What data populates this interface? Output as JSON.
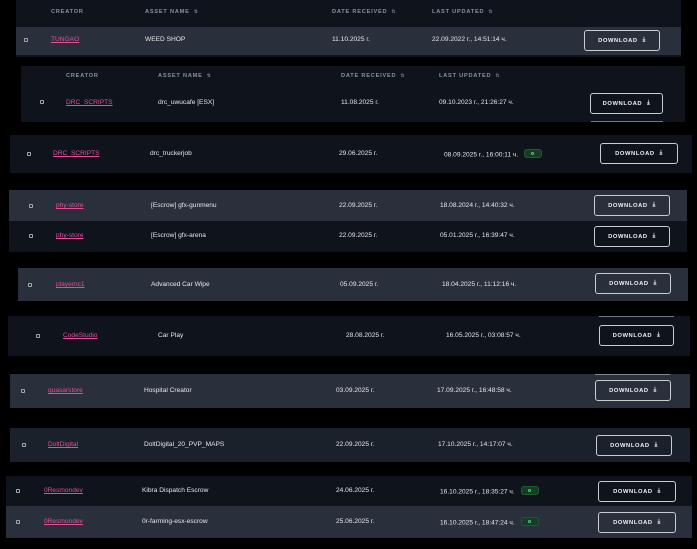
{
  "header1": {
    "creator": "CREATOR",
    "asset_name": "ASSET NAME",
    "date_received": "DATE RECEIVED",
    "last_updated": "LAST UPDATED"
  },
  "header2": {
    "creator": "CREATOR",
    "asset_name": "ASSET NAME",
    "date_received": "DATE RECEIVED",
    "last_updated": "LAST UPDATED"
  },
  "sort_glyph": "⇅",
  "download_label": "DOWNLOAD",
  "download_icon": "⤓",
  "rows": [
    {
      "creator": "TUNGAO",
      "asset": "WEED SHOP",
      "date_received": "11.10.2025 г.",
      "last_updated": "22.09.2022 г., 14:51:14 ч.",
      "badge": false
    },
    {
      "creator": "DRC_SCRIPTS",
      "asset": "drc_uwucafe [ESX]",
      "date_received": "11.08.2025 г.",
      "last_updated": "09.10.2023 г., 21:26:27 ч.",
      "badge": false
    },
    {
      "creator": "DRC_SCRIPTS",
      "asset": "drc_truckerjob",
      "date_received": "29.06.2025 г.",
      "last_updated": "08.09.2025 г., 16:00:11 ч.",
      "badge": true
    },
    {
      "creator": "phy-store",
      "asset": "[Escrow] gfx-gunmenu",
      "date_received": "22.09.2025 г.",
      "last_updated": "18.08.2024 г., 14:40:32 ч.",
      "badge": false
    },
    {
      "creator": "phy-store",
      "asset": "[Escrow] gfx-arena",
      "date_received": "22.09.2025 г.",
      "last_updated": "05.01.2025 г., 16:39:47 ч.",
      "badge": false
    },
    {
      "creator": "playernc1",
      "asset": "Advanced Car Wipe",
      "date_received": "05.09.2025 г.",
      "last_updated": "18.04.2025 г., 11:12:16 ч.",
      "badge": false
    },
    {
      "creator": "CodeStudio",
      "asset": "Car Play",
      "date_received": "28.08.2025 г.",
      "last_updated": "16.05.2025 г., 03:08:57 ч.",
      "badge": false
    },
    {
      "creator": "quasarstore",
      "asset": "Hospital Creator",
      "date_received": "03.09.2025 г.",
      "last_updated": "17.09.2025 г., 16:48:58 ч.",
      "badge": false
    },
    {
      "creator": "DoltDigital",
      "asset": "DoltDigital_20_PVP_MAPS",
      "date_received": "22.09.2025 г.",
      "last_updated": "17.10.2025 г., 14:17:07 ч.",
      "badge": false
    },
    {
      "creator": "0Resmondev",
      "asset": "Kibra Dispatch Escrow",
      "date_received": "24.06.2025 г.",
      "last_updated": "16.10.2025 г., 18:35:27 ч.",
      "badge": true
    },
    {
      "creator": "0Resmondev",
      "asset": "0r-farming-esx-escrow",
      "date_received": "25.06.2025 г.",
      "last_updated": "16.10.2025 г., 18:47:24 ч.",
      "badge": true
    }
  ]
}
